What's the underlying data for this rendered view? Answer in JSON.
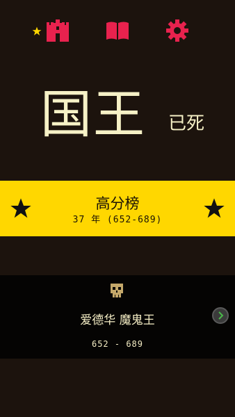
{
  "colors": {
    "background": "#1c130d",
    "accent": "#e8224e",
    "band": "#ffd700",
    "text": "#f6f1c6",
    "star_small": "#ffd700",
    "next_chevron": "#4ab84a"
  },
  "topbar": {
    "icons": [
      "star-icon",
      "castle-icon",
      "book-icon",
      "gear-icon"
    ]
  },
  "title": {
    "main": "国王",
    "sub": "已死"
  },
  "highscore": {
    "label": "高分榜",
    "years": "37 年 (652-689)"
  },
  "king": {
    "name": "爱德华  魔鬼王",
    "years": "652 - 689"
  }
}
